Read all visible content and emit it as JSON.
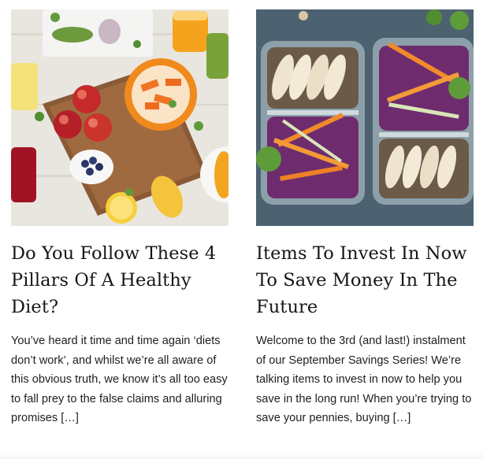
{
  "posts": [
    {
      "title": "Do You Follow These 4 Pillars Of A Healthy Diet?",
      "excerpt": "You’ve heard it time and time again ‘diets don’t work’, and whilst we’re all aware of this obvious truth, we know it’s all too easy to fall prey to the false claims and alluring promises […]"
    },
    {
      "title": "Items To Invest In Now To Save Money In The Future",
      "excerpt": "Welcome to the 3rd (and last!) instalment of our September Savings Series! We’re talking items to invest in now to help you save in the long run! When you’re trying to save your pennies, buying […]"
    }
  ]
}
